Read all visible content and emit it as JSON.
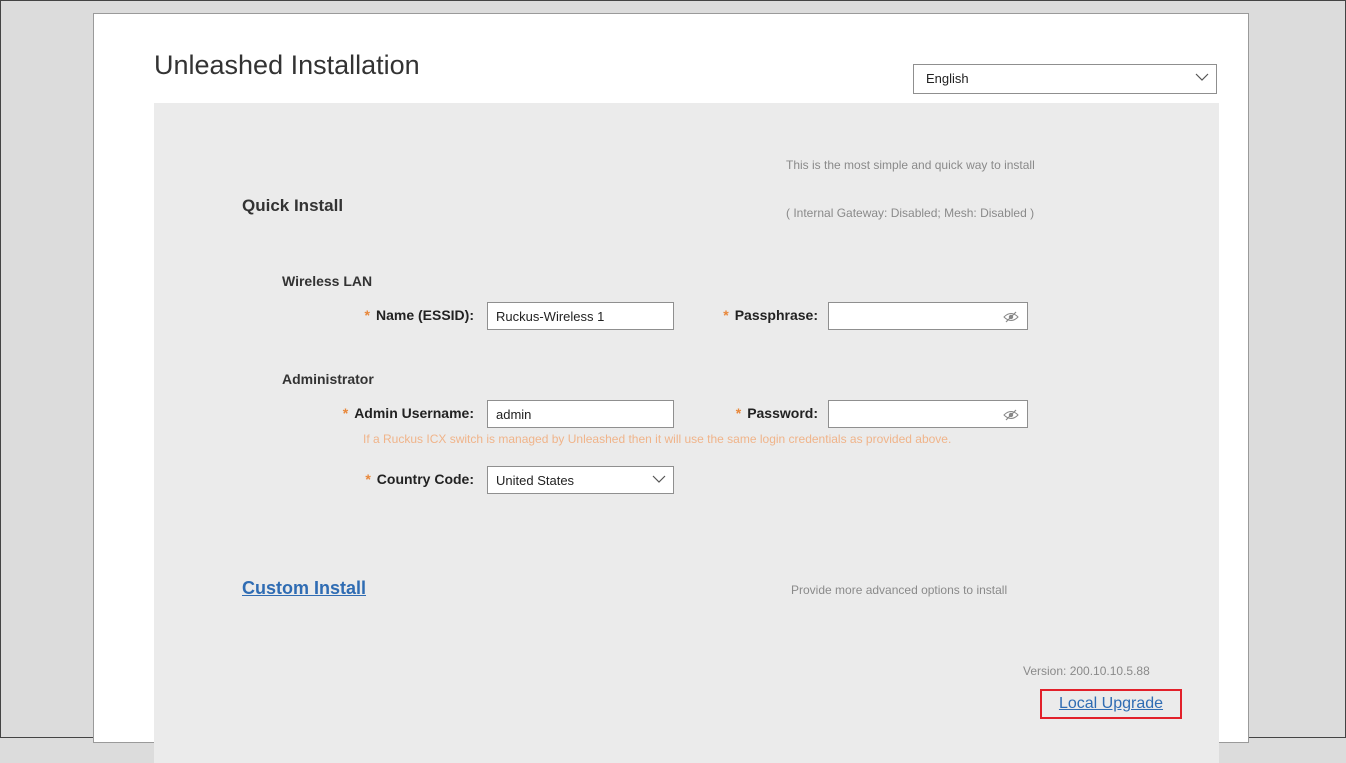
{
  "header": {
    "title": "Unleashed Installation",
    "language": {
      "selected": "English",
      "icon": "chevron-down-icon"
    }
  },
  "quick_install": {
    "title": "Quick Install",
    "description": "This is the most simple and quick way to install",
    "details": "( Internal Gateway: Disabled; Mesh: Disabled )"
  },
  "wireless_lan": {
    "section_label": "Wireless LAN",
    "essid_label": "Name (ESSID):",
    "essid_value": "Ruckus-Wireless 1",
    "passphrase_label": "Passphrase:",
    "passphrase_value": ""
  },
  "administrator": {
    "section_label": "Administrator",
    "username_label": "Admin Username:",
    "username_value": "admin",
    "password_label": "Password:",
    "password_value": "",
    "note": "If a Ruckus ICX switch is managed by Unleashed then it will use the same login credentials as provided above.",
    "country_label": "Country Code:",
    "country_value": "United States"
  },
  "required_marker": "*",
  "custom_install": {
    "link": "Custom Install",
    "description": "Provide more advanced options to install"
  },
  "footer": {
    "version": "Version: 200.10.10.5.88",
    "local_upgrade": "Local Upgrade"
  },
  "colors": {
    "link": "#2f6cb3",
    "required": "#e8873a",
    "note": "#f0b48a",
    "highlight_border": "#e2202a",
    "panel_bg": "#ebebeb"
  }
}
